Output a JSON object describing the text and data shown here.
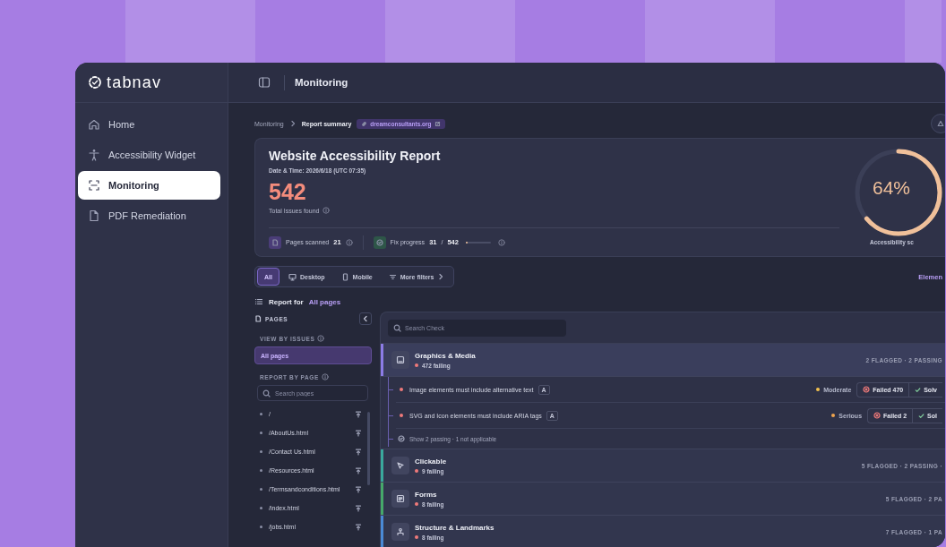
{
  "brand": {
    "name": "tabnav"
  },
  "nav": [
    {
      "label": "Home",
      "kind": "home",
      "selected": false
    },
    {
      "label": "Accessibility Widget",
      "kind": "accessibility",
      "selected": false
    },
    {
      "label": "Monitoring",
      "kind": "monitoring",
      "selected": true
    },
    {
      "label": "PDF Remediation",
      "kind": "pdf",
      "selected": false
    }
  ],
  "header": {
    "title": "Monitoring"
  },
  "breadcrumb": {
    "items": [
      "Monitoring",
      "Report summary"
    ],
    "site": "dreamconsultants.org"
  },
  "report": {
    "title": "Website Accessibility Report",
    "date": "Date & Time: 2026/6/18 (UTC 07:35)",
    "total": "542",
    "total_label": "Total Issues found",
    "pages_scanned": {
      "label": "Pages scanned",
      "value": "21"
    },
    "fix_progress": {
      "label": "Fix progress",
      "done": "31",
      "separator": "/",
      "total": "542",
      "level": 0.06
    },
    "score": {
      "value": "64%",
      "label": "Accessibility sc",
      "level": 0.64
    }
  },
  "filters": [
    {
      "label": "All",
      "kind": "all",
      "selected": true
    },
    {
      "label": "Desktop",
      "kind": "desktop",
      "selected": false
    },
    {
      "label": "Mobile",
      "kind": "mobile",
      "selected": false
    },
    {
      "label": "More filters",
      "kind": "more",
      "selected": false
    }
  ],
  "elements_link": "Elemen",
  "report_for": {
    "label": "Report for",
    "value": "All pages"
  },
  "pages_panel": {
    "title": "PAGES",
    "view_by_issues": "VIEW BY ISSUES",
    "views": [
      {
        "label": "All pages",
        "selected": true
      }
    ],
    "report_by_page": "REPORT BY PAGE",
    "search_placeholder": "Search pages",
    "pages": [
      "/",
      "/AboutUs.html",
      "/Contact Us.html",
      "/Resources.html",
      "/Termsandconditions.html",
      "/index.html",
      "/jobs.html"
    ]
  },
  "checks": {
    "search_placeholder": "Search Check",
    "categories": [
      {
        "name": "Graphics & Media",
        "kind": "graphics",
        "failing": "472 failing",
        "summary": "2 FLAGGED · 2 PASSING",
        "color": "#8c7ce6",
        "expanded": true,
        "checks": [
          {
            "title": "Image elements must include alternative text",
            "badge": "A",
            "severity": "Moderate",
            "color": "#f2c14e",
            "failed": "Failed 470",
            "solved": "Solv"
          },
          {
            "title": "SVG and Icon elements must include ARIA tags",
            "badge": "A",
            "severity": "Serious",
            "color": "#f0a54e",
            "failed": "Failed 2",
            "solved": "Sol"
          }
        ],
        "footer": "Show 2 passing · 1 not applicable"
      },
      {
        "name": "Clickable",
        "kind": "clickable",
        "failing": "9 failing",
        "summary": "5 FLAGGED · 2 PASSING ·",
        "color": "#3aa89c",
        "expanded": false
      },
      {
        "name": "Forms",
        "kind": "forms",
        "failing": "8 failing",
        "summary": "5 FLAGGED · 2 PA",
        "color": "#46a86a",
        "expanded": false
      },
      {
        "name": "Structure & Landmarks",
        "kind": "structure",
        "failing": "8 failing",
        "summary": "7 FLAGGED · 1 PA",
        "color": "#4a8ad6",
        "expanded": false
      }
    ]
  }
}
